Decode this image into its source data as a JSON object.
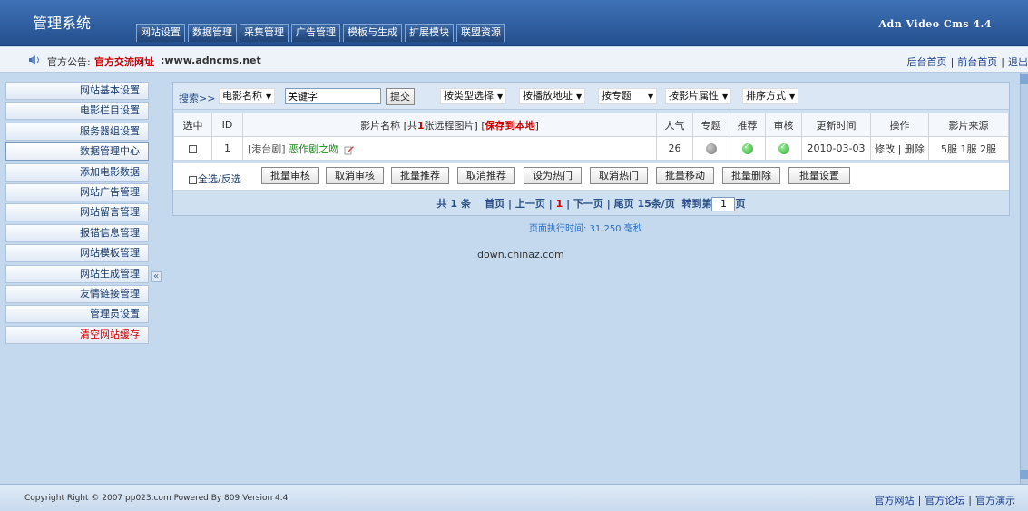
{
  "header": {
    "logo": "管理系统",
    "brand": "Adn Video Cms 4.4",
    "nav": [
      "网站设置",
      "数据管理",
      "采集管理",
      "广告管理",
      "模板与生成",
      "扩展模块",
      "联盟资源"
    ]
  },
  "notice": {
    "label": "官方公告:",
    "link": "官方交流网址",
    "url": ":www.adncms.net",
    "top_links": [
      "后台首页",
      "前台首页",
      "退出"
    ]
  },
  "sidebar": {
    "items": [
      "网站基本设置",
      "电影栏目设置",
      "服务器组设置",
      "数据管理中心",
      "添加电影数据",
      "网站广告管理",
      "网站留言管理",
      "报错信息管理",
      "网站模板管理",
      "网站生成管理",
      "友情链接管理",
      "管理员设置",
      "清空网站缓存"
    ],
    "collapse": "«"
  },
  "search": {
    "label": "搜索>>",
    "field_select": "电影名称",
    "keyword_value": "关键字",
    "submit": "提交",
    "filters": [
      "按类型选择",
      "按播放地址",
      "按专题",
      "按影片属性",
      "排序方式"
    ]
  },
  "table": {
    "headers": {
      "select": "选中",
      "id": "ID",
      "name_prefix": "影片名称 [共",
      "remote_count": "1",
      "name_mid": "张远程图片] [",
      "save_local": "保存到本地",
      "name_suffix": "]",
      "hits": "人气",
      "topic": "专题",
      "recommend": "推荐",
      "review": "审核",
      "updated": "更新时间",
      "ops": "操作",
      "source": "影片来源"
    },
    "rows": [
      {
        "id": "1",
        "genre": "[港台剧]",
        "title": "恶作剧之吻",
        "hits": "26",
        "updated": "2010-03-03",
        "edit": "修改",
        "delete": "删除",
        "source": "5服 1服 2服"
      }
    ]
  },
  "actions": {
    "select_all": "全选/反选",
    "buttons": [
      "批量审核",
      "取消审核",
      "批量推荐",
      "取消推荐",
      "设为热门",
      "取消热门",
      "批量移动",
      "批量删除",
      "批量设置"
    ]
  },
  "pager": {
    "total": "共 1 条",
    "first": "首页",
    "prev": "上一页",
    "current": "1",
    "next": "下一页",
    "last": "尾页",
    "per_page": "15条/页",
    "goto_prefix": "转到第",
    "goto_value": "1",
    "goto_suffix": "页"
  },
  "exec_time": "页面执行时间: 31.250 毫秒",
  "watermark": "down.chinaz.com",
  "footer": {
    "copyright": "Copyright Right © 2007 pp023.com Powered By 809 Version 4.4",
    "links": [
      "官方网站",
      "官方论坛",
      "官方演示"
    ]
  },
  "colors": {
    "accent": "#2a4f88",
    "alert": "#cc0000",
    "link_green": "#1a8a1a"
  }
}
